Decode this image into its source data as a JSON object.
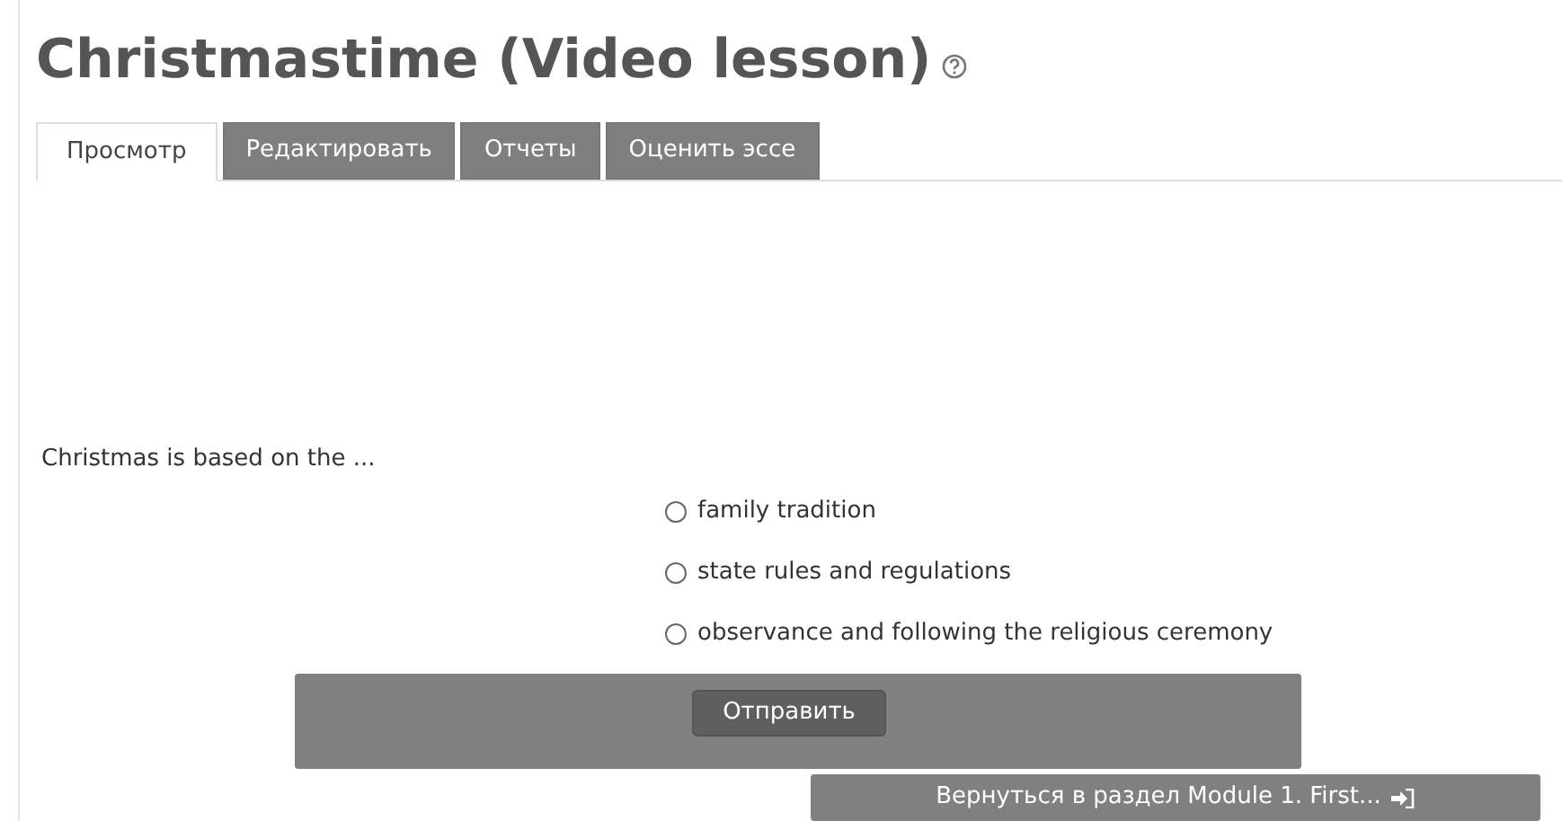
{
  "title": "Christmastime (Video lesson)",
  "tabs": [
    {
      "label": "Просмотр",
      "selected": true
    },
    {
      "label": "Редактировать",
      "selected": false
    },
    {
      "label": "Отчеты",
      "selected": false
    },
    {
      "label": "Оценить эссе",
      "selected": false
    }
  ],
  "question": "Christmas is based on the ...",
  "options": [
    {
      "label": "family tradition",
      "selected": false
    },
    {
      "label": "state rules and regulations",
      "selected": false
    },
    {
      "label": "observance and following the religious ceremony",
      "selected": false
    }
  ],
  "submit_button": "Отправить",
  "return_button": "Вернуться в раздел Module 1. First..."
}
